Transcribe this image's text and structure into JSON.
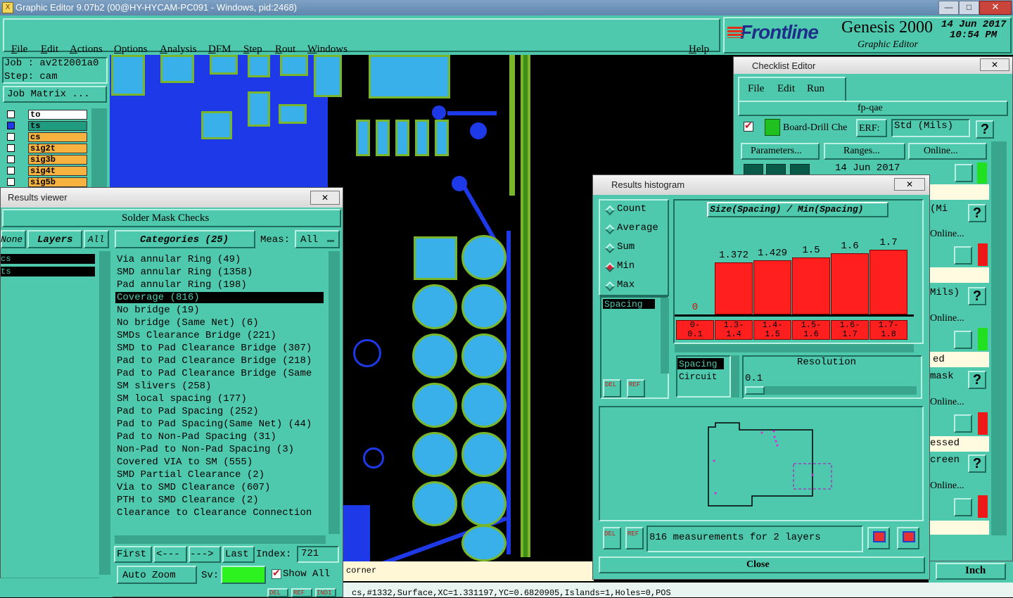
{
  "window": {
    "title": "Graphic Editor 9.07b2 (00@HY-HYCAM-PC091 - Windows, pid:2468)"
  },
  "menu": [
    "File",
    "Edit",
    "Actions",
    "Options",
    "Analysis",
    "DFM",
    "Step",
    "Rout",
    "Windows"
  ],
  "help": "Help",
  "brand": {
    "logo": "Frontline",
    "product": "Genesis 2000",
    "subtitle": "Graphic Editor",
    "date": "14 Jun 2017",
    "time": "10:54 PM"
  },
  "job": {
    "job_label": "Job : av2t2001a0",
    "step_label": "Step: cam",
    "matrix_button": "Job Matrix ..."
  },
  "layers": [
    {
      "name": "to",
      "color": "#ffffff"
    },
    {
      "name": "ts",
      "color": "#1f9c7f"
    },
    {
      "name": "cs",
      "color": "#f8b240"
    },
    {
      "name": "sig2t",
      "color": "#f8b240"
    },
    {
      "name": "sig3b",
      "color": "#f8b240"
    },
    {
      "name": "sig4t",
      "color": "#f8b240"
    },
    {
      "name": "sig5b",
      "color": "#f8b240"
    }
  ],
  "results_viewer": {
    "title": "Results viewer",
    "header": "Solder Mask Checks",
    "none_btn": "None",
    "layers_btn": "Layers",
    "all_btn": "All",
    "categories_btn": "Categories (25)",
    "meas_label": "Meas:",
    "meas_value": "All",
    "left_rows": [
      "cs",
      "ts"
    ],
    "categories": [
      "Via annular Ring (49)",
      "SMD annular Ring (1358)",
      "Pad annular Ring (198)",
      "Coverage (816)",
      "No bridge (19)",
      "No bridge (Same Net) (6)",
      "SMDs Clearance Bridge (221)",
      "SMD to Pad Clearance Bridge (307)",
      "Pad to Pad Clearance Bridge (218)",
      "Pad to Pad Clearance Bridge (Same",
      "SM slivers (258)",
      "SM local spacing (177)",
      "Pad to Pad Spacing (252)",
      "Pad to Pad Spacing(Same Net) (44)",
      "Pad to Non-Pad Spacing (31)",
      "Non-Pad to Non-Pad Spacing (3)",
      "Covered VIA to SM (555)",
      "SMD Partial Clearance (2)",
      "Via to SMD Clearance (607)",
      "PTH to SMD Clearance (2)",
      "Clearance to Clearance Connection"
    ],
    "selected_index": 3,
    "nav": {
      "first": "First",
      "prev": "<---",
      "next": "--->",
      "last": "Last",
      "index_label": "Index:",
      "index_value": "721"
    },
    "auto_zoom": "Auto Zoom",
    "sv_label": "Sv:",
    "show_all": "Show All",
    "bottom_btns": [
      "DEL",
      "REF",
      "INDI"
    ]
  },
  "status": {
    "corner": "corner",
    "info": "cs,#1332,Surface,XC=1.331197,YC=0.6820905,Islands=1,Holes=0,POS",
    "units": "Inch"
  },
  "histogram": {
    "title": "Results histogram",
    "modes": [
      "Count",
      "Average",
      "Sum",
      "Min",
      "Max"
    ],
    "selected_mode": "Min",
    "list_item": "Spacing",
    "chart_title": "Size(Spacing) / Min(Spacing)",
    "spacing_list": [
      "Spacing",
      "Circuit"
    ],
    "resolution_label": "Resolution",
    "resolution_value": "0.1",
    "measurements": "816 measurements for 2 layers",
    "close": "Close",
    "del": "DEL",
    "ref": "REF"
  },
  "chart_data": {
    "type": "bar",
    "title": "Size(Spacing) / Min(Spacing)",
    "categories": [
      "0-0.1",
      "1.3-1.4",
      "1.4-1.5",
      "1.5-1.6",
      "1.6-1.7",
      "1.7-1.8"
    ],
    "range_lines": [
      [
        "0-",
        "0.1"
      ],
      [
        "1.3-",
        "1.4"
      ],
      [
        "1.4-",
        "1.5"
      ],
      [
        "1.5-",
        "1.6"
      ],
      [
        "1.6-",
        "1.7"
      ],
      [
        "1.7-",
        "1.8"
      ]
    ],
    "values": [
      0,
      1.372,
      1.429,
      1.5,
      1.6,
      1.7
    ],
    "labels": [
      "0",
      "1.372",
      "1.429",
      "1.5",
      "1.6",
      "1.7"
    ],
    "ylim": [
      0,
      1.7
    ],
    "color": "#ff1f1f"
  },
  "checklist": {
    "title": "Checklist Editor",
    "menu": [
      "File",
      "Edit",
      "Run"
    ],
    "name": "fp-qae",
    "row_label": "Board-Drill Che",
    "erf": "ERF:",
    "erf_value": "Std (Mils)",
    "buttons": [
      "Parameters...",
      "Ranges...",
      "Online..."
    ],
    "date": "14 Jun 2017",
    "side_texts": [
      "(Mi",
      "Online...",
      "Mils)",
      "Online...",
      "ed",
      "mask",
      "Online...",
      "essed",
      "creen",
      "Online..."
    ]
  }
}
